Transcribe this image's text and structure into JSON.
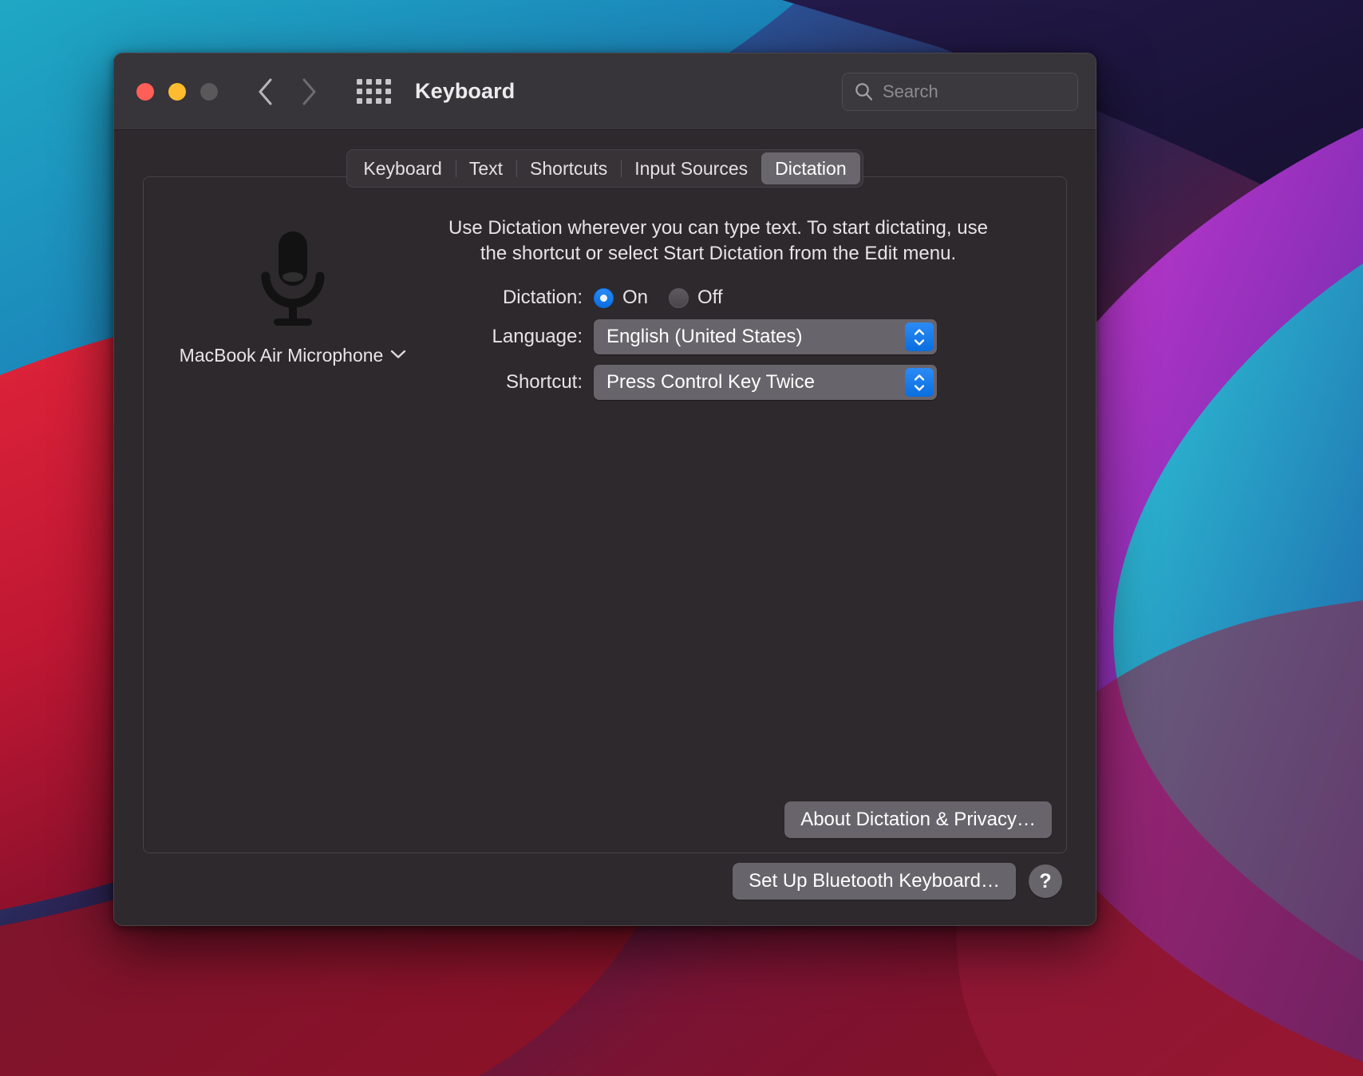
{
  "window": {
    "title": "Keyboard",
    "traffic_lights": [
      {
        "name": "close",
        "color": "#ff5f57"
      },
      {
        "name": "minimize",
        "color": "#febc2e"
      },
      {
        "name": "zoom",
        "color": "#5b585c"
      }
    ],
    "nav": {
      "back_icon": "chevron-left-icon",
      "forward_icon": "chevron-right-icon"
    },
    "grid_icon": "show-all-grid-icon"
  },
  "search": {
    "value": "",
    "placeholder": "Search",
    "icon": "search-icon"
  },
  "tabs": [
    {
      "label": "Keyboard",
      "selected": false
    },
    {
      "label": "Text",
      "selected": false
    },
    {
      "label": "Shortcuts",
      "selected": false
    },
    {
      "label": "Input Sources",
      "selected": false
    },
    {
      "label": "Dictation",
      "selected": true
    }
  ],
  "microphone": {
    "icon": "microphone-icon",
    "label": "MacBook Air Microphone",
    "chevron_icon": "chevron-down-icon"
  },
  "description": "Use Dictation wherever you can type text. To start dictating, use the shortcut or select Start Dictation from the Edit menu.",
  "form": {
    "dictation": {
      "label": "Dictation:",
      "options": [
        {
          "label": "On",
          "selected": true
        },
        {
          "label": "Off",
          "selected": false
        }
      ]
    },
    "language": {
      "label": "Language:",
      "value": "English (United States)",
      "stepper_icon": "stepper-up-down-icon"
    },
    "shortcut": {
      "label": "Shortcut:",
      "value": "Press Control Key Twice",
      "stepper_icon": "stepper-up-down-icon"
    }
  },
  "buttons": {
    "about_privacy": "About Dictation & Privacy…",
    "setup_bluetooth": "Set Up Bluetooth Keyboard…",
    "help": "?"
  },
  "colors": {
    "accent_blue": "#0a6ee0",
    "window_bg": "#2d292c",
    "titlebar_bg": "#37343a",
    "control_gray": "#68646b"
  }
}
